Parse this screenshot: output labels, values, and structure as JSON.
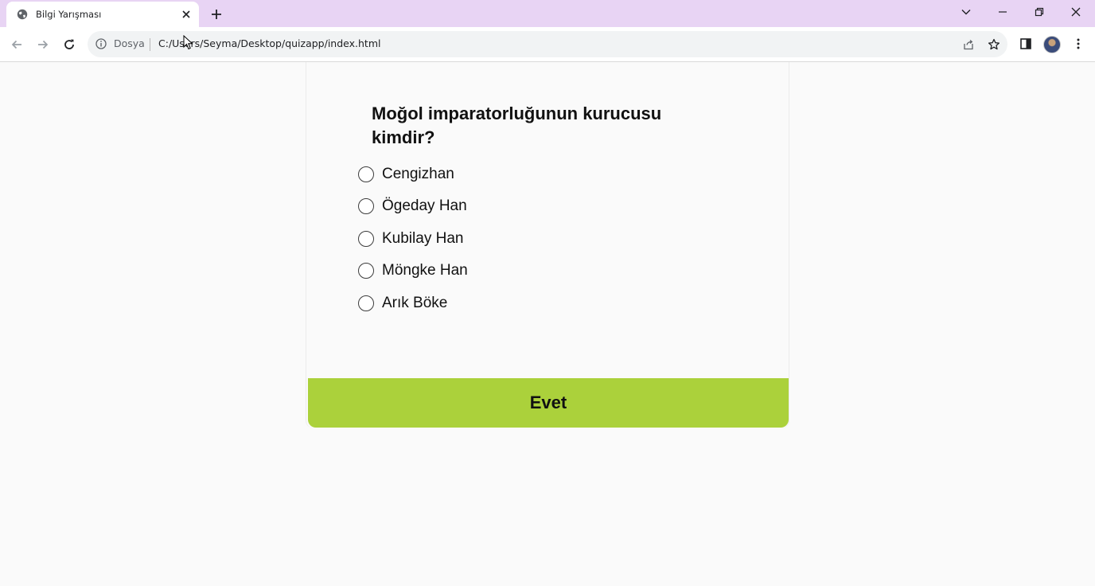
{
  "browser": {
    "tab": {
      "title": "Bilgi Yarışması"
    },
    "address_bar": {
      "site_label": "Dosya",
      "url": "C:/Users/Seyma/Desktop/quizapp/index.html"
    },
    "colors": {
      "titlebar": "#e8d4f4",
      "toolbar": "#ffffff",
      "omnibox": "#f1f3f4"
    }
  },
  "quiz": {
    "question": "Moğol imparatorluğunun kurucusu kimdir?",
    "answers": [
      {
        "label": "Cengizhan",
        "selected": false
      },
      {
        "label": "Ögeday Han",
        "selected": false
      },
      {
        "label": "Kubilay Han",
        "selected": false
      },
      {
        "label": "Möngke Han",
        "selected": false
      },
      {
        "label": "Arık Böke",
        "selected": false
      }
    ],
    "submit_label": "Evet",
    "colors": {
      "submit": "#abd13b",
      "background": "#fafafa"
    }
  }
}
